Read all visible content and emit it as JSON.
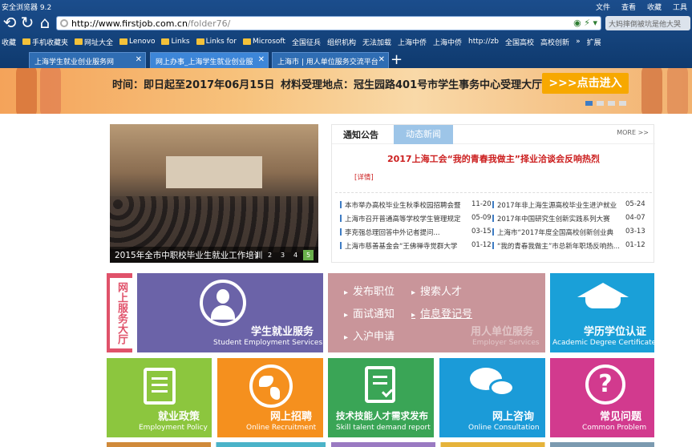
{
  "browser": {
    "app_title": "安全浏览器 9.2",
    "menu": [
      "文件",
      "查看",
      "收藏",
      "工具"
    ],
    "url_host": "http://www.firstjob.com.cn",
    "url_path": "/folder76/",
    "search_placeholder": "大妈摔倒被坑是他大哭",
    "bookmarks": [
      "收藏",
      "手机收藏夹",
      "网址大全",
      "Lenovo",
      "Links",
      "Links for",
      "Microsoft",
      "全国征兵",
      "组织机构",
      "无法加载",
      "上海中侨",
      "上海中侨",
      "http://zb",
      "全国高校",
      "高校创新",
      "»",
      "扩展"
    ],
    "tabs": [
      "上海学生就业创业服务网",
      "网上办事_上海学生就业创业服",
      "上海市 | 用人单位服务交流平台"
    ],
    "new_tab": "+"
  },
  "banner": {
    "time_label": "时间：即日起至2017年06月15日",
    "location_label": "材料受理地点：冠生园路401号市学生事务中心受理大厅",
    "cta": ">>>点击进入"
  },
  "photo": {
    "caption": "2015年全市中职校毕业生就业工作培训",
    "pages": [
      "1",
      "2",
      "3",
      "4",
      "5"
    ]
  },
  "news": {
    "tab_notice": "通知公告",
    "tab_dynamic": "动态新闻",
    "more": "MORE >>",
    "headline": "2017上海工会“我的青春我做主”择业洽谈会反响热烈",
    "detail": "[详情]",
    "left_items": [
      {
        "title": "本市举办高校毕业生秋季校园招聘会暨",
        "date": "11-20"
      },
      {
        "title": "上海市召开普通高等学校学生管理规定",
        "date": "05-09"
      },
      {
        "title": "李克强总理回答中外记者提问...",
        "date": "03-15"
      },
      {
        "title": "上海市慈善基金会“王佛禅寺觉群大学",
        "date": "01-12"
      }
    ],
    "right_items": [
      {
        "title": "2017年非上海生源高校毕业生进沪就业",
        "date": "05-24"
      },
      {
        "title": "2017年中国研究生创新实践系列大赛",
        "date": "04-07"
      },
      {
        "title": "上海市“2017年度全国高校创新创业典",
        "date": "03-13"
      },
      {
        "title": "“我的青春我做主”市总新年职场反响热...",
        "date": "01-12"
      }
    ]
  },
  "services": {
    "online_label": "网上服务大厅",
    "student": {
      "zh": "学生就业服务",
      "en": "Student Employment Services"
    },
    "employer": {
      "menu": [
        "发布职位",
        "搜索人才",
        "面试通知",
        "信息登记号",
        "入沪申请"
      ],
      "zh": "用人单位服务",
      "en": "Employer Services"
    },
    "degree": {
      "zh": "学历学位认证",
      "en": "Academic Degree Certificate"
    },
    "policy": {
      "zh": "就业政策",
      "en": "Employment Policy"
    },
    "recruit": {
      "zh": "网上招聘",
      "en": "Online Recruitment"
    },
    "skill": {
      "zh": "技术技能人才需求发布",
      "en": "Skill talent demand report"
    },
    "consult": {
      "zh": "网上咨询",
      "en": "Online Consultation"
    },
    "faq": {
      "zh": "常见问题",
      "en": "Common Problem"
    }
  },
  "colors": {
    "student": "#6b63a8",
    "employer": "#c9959a",
    "degree": "#1aa0d8",
    "policy": "#8cc63e",
    "recruit": "#f5901e",
    "skill": "#3aa556",
    "consult": "#1b9bd8",
    "faq": "#d23a8e",
    "online": "#e0526a"
  }
}
